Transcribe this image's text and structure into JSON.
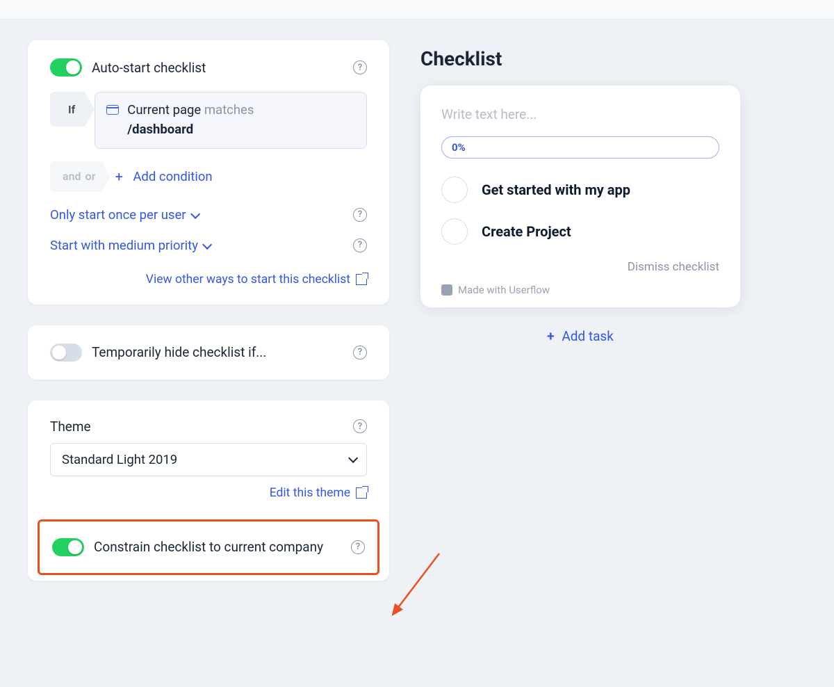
{
  "settings": {
    "autostart": {
      "label": "Auto-start checklist",
      "enabled": true,
      "if_label": "If",
      "condition": {
        "prefix": "Current page",
        "verb": "matches",
        "value": "/dashboard"
      },
      "andor": {
        "and": "and",
        "or": "or"
      },
      "add_condition": "Add condition",
      "once_per_user": "Only start once per user",
      "priority": "Start with medium priority",
      "other_ways": "View other ways to start this checklist"
    },
    "hide": {
      "label": "Temporarily hide checklist if...",
      "enabled": false
    },
    "theme": {
      "title": "Theme",
      "selected": "Standard Light 2019",
      "edit_link": "Edit this theme"
    },
    "constrain": {
      "label": "Constrain checklist to current company",
      "enabled": true
    }
  },
  "preview": {
    "title": "Checklist",
    "placeholder": "Write text here...",
    "progress": "0%",
    "tasks": [
      {
        "label": "Get started with my app"
      },
      {
        "label": "Create Project"
      }
    ],
    "dismiss": "Dismiss checklist",
    "made_with": "Made with Userflow",
    "add_task": "Add task"
  }
}
